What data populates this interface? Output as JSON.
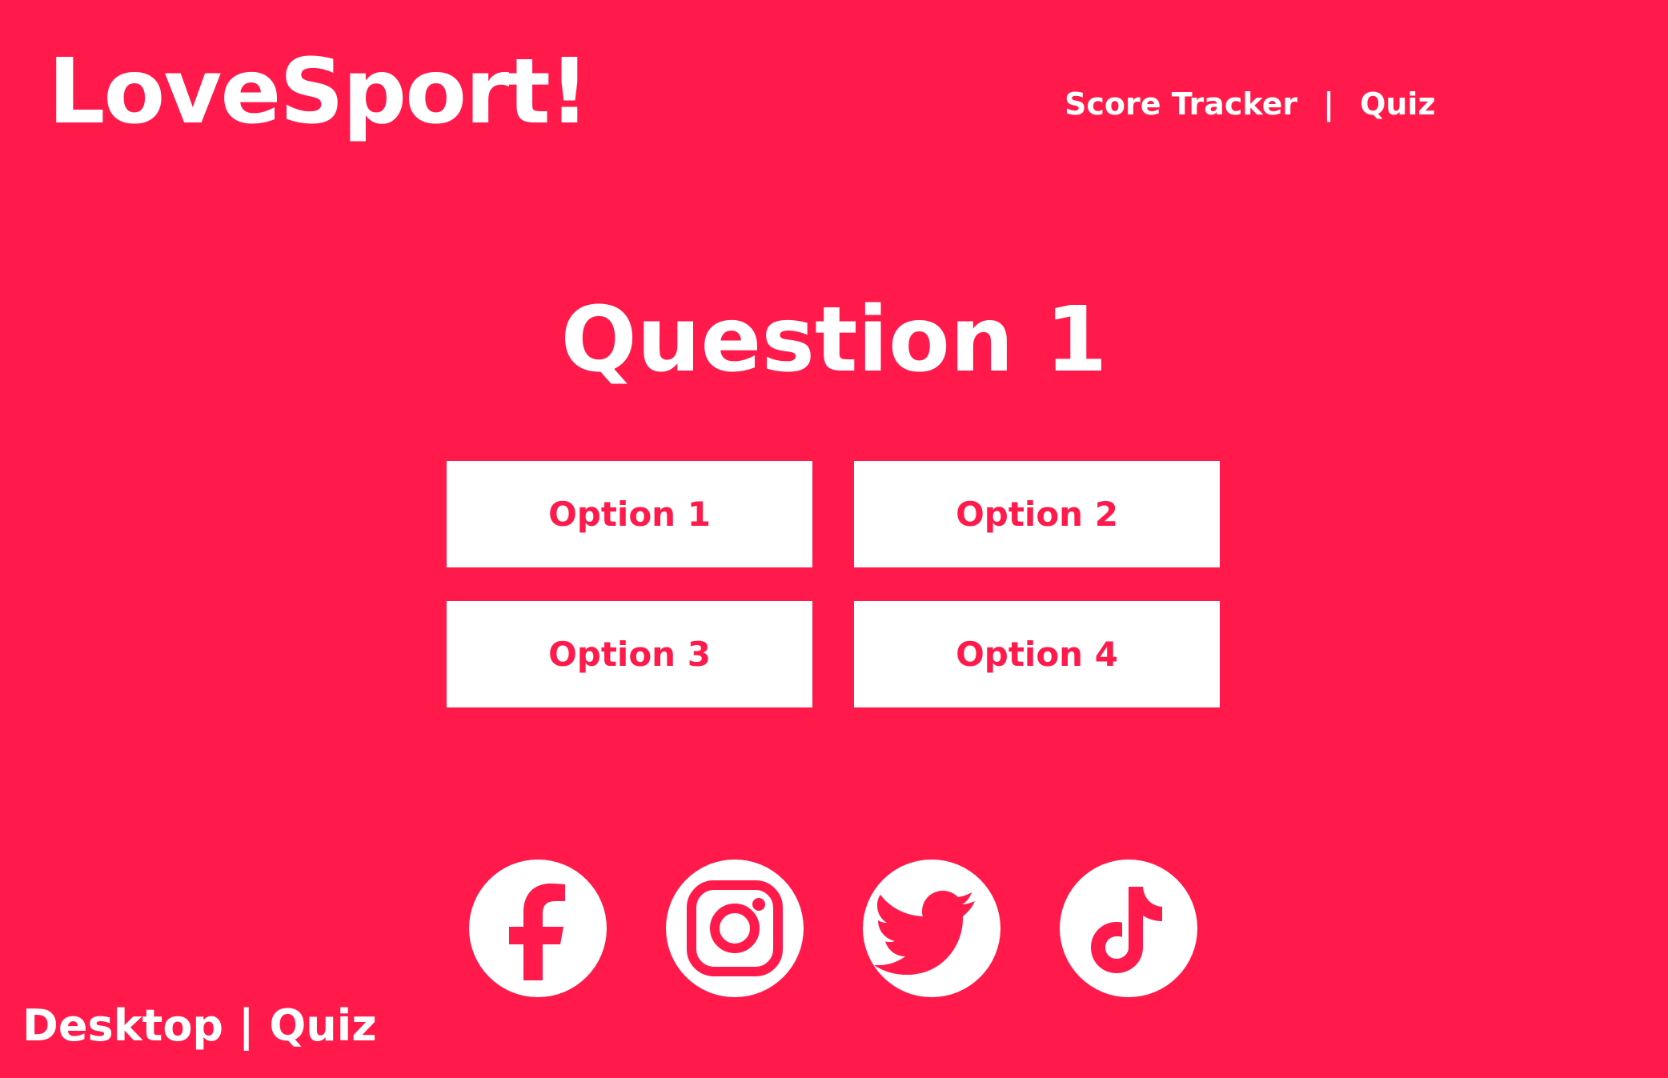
{
  "brand": {
    "logo_text": "LoveSport!"
  },
  "nav": {
    "items": [
      {
        "label": "Score Tracker"
      },
      {
        "label": "Quiz"
      }
    ],
    "separator": "|"
  },
  "quiz": {
    "question_title": "Question 1",
    "options": [
      {
        "label": "Option 1"
      },
      {
        "label": "Option 2"
      },
      {
        "label": "Option 3"
      },
      {
        "label": "Option 4"
      }
    ]
  },
  "social": {
    "icons": [
      "facebook-icon",
      "instagram-icon",
      "twitter-icon",
      "tiktok-icon"
    ]
  },
  "footer": {
    "label": "Desktop | Quiz"
  },
  "colors": {
    "background": "#FF1A4B",
    "foreground": "#FFFFFF"
  }
}
